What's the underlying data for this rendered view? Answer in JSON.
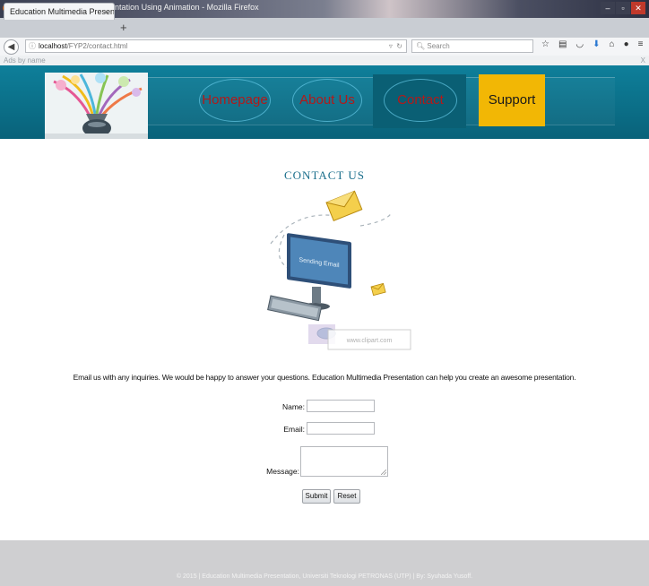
{
  "browser": {
    "window_title": "Education Multimedia Presentation Using Animation - Mozilla Firefox",
    "tab_title": "Education Multimedia Presenta...",
    "tab_close": "×",
    "new_tab": "+",
    "url_host": "localhost",
    "url_path": "/FYP2/contact.html",
    "search_placeholder": "Search",
    "ads_label": "Ads by name",
    "ads_close": "X"
  },
  "site": {
    "nav": {
      "home": "Homepage",
      "about": "About Us",
      "contact": "Contact",
      "support": "Support"
    },
    "heading": "CONTACT US",
    "illustration_text": {
      "screen": "Sending Email",
      "watermark": "www.clipart.com"
    },
    "intro": "Email us with any inquiries. We would be happy to answer your questions. Education Multimedia Presentation can help you create an awesome presentation.",
    "form": {
      "name_label": "Name:",
      "email_label": "Email:",
      "message_label": "Message:",
      "submit_label": "Submit",
      "reset_label": "Reset"
    },
    "footer": "© 2015 | Education Multimedia Presentation, Universiti Teknologi PETRONAS (UTP) | By: Syuhada Yusoff."
  },
  "colors": {
    "header_teal": "#0b6e87",
    "nav_text_red": "#b31919",
    "support_yellow": "#f2b705",
    "heading_blue": "#1b6f8c",
    "footer_gray": "#cfcfd1"
  }
}
